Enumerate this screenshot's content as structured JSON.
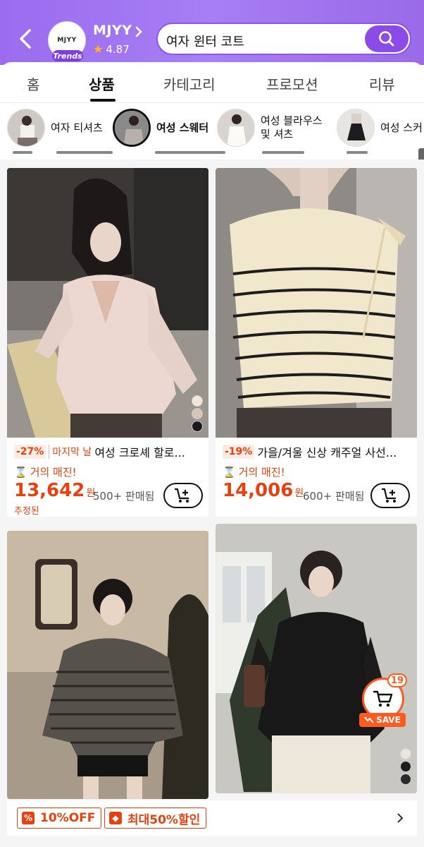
{
  "header": {
    "store_logo_text": "MJYY",
    "store_badge": "Trends",
    "store_name": "MJYY",
    "rating": "4.87",
    "search_query": "여자 윈터 코트"
  },
  "tabs": [
    {
      "label": "홈"
    },
    {
      "label": "상품"
    },
    {
      "label": "카테고리"
    },
    {
      "label": "프로모션"
    },
    {
      "label": "리뷰"
    }
  ],
  "categories": [
    {
      "label": "여자 티셔츠"
    },
    {
      "label": "여성 스웨터"
    },
    {
      "label": "여성 블라우스\n및 셔츠"
    },
    {
      "label": "여성 스커"
    }
  ],
  "products": [
    {
      "discount": "-27%",
      "deal": "마지막 날",
      "title": "여성 크로셰 할로...",
      "stock": "거의 매진!",
      "price": "13,642",
      "currency": "원",
      "sold": "500+ 판매됨",
      "estimated": "추정된"
    },
    {
      "discount": "-19%",
      "title": "가을/겨울 신상 캐주얼 사선...",
      "stock": "거의 매진!",
      "price": "14,006",
      "currency": "원",
      "sold": "600+ 판매됨"
    }
  ],
  "cart": {
    "count": "19",
    "save_label": "SAVE"
  },
  "promo": {
    "coupon1": "10%OFF",
    "coupon2": "최대50%할인"
  },
  "colors": {
    "accent": "#e8410e",
    "brand": "#9b6cf0",
    "cart": "#ff5a1f"
  }
}
